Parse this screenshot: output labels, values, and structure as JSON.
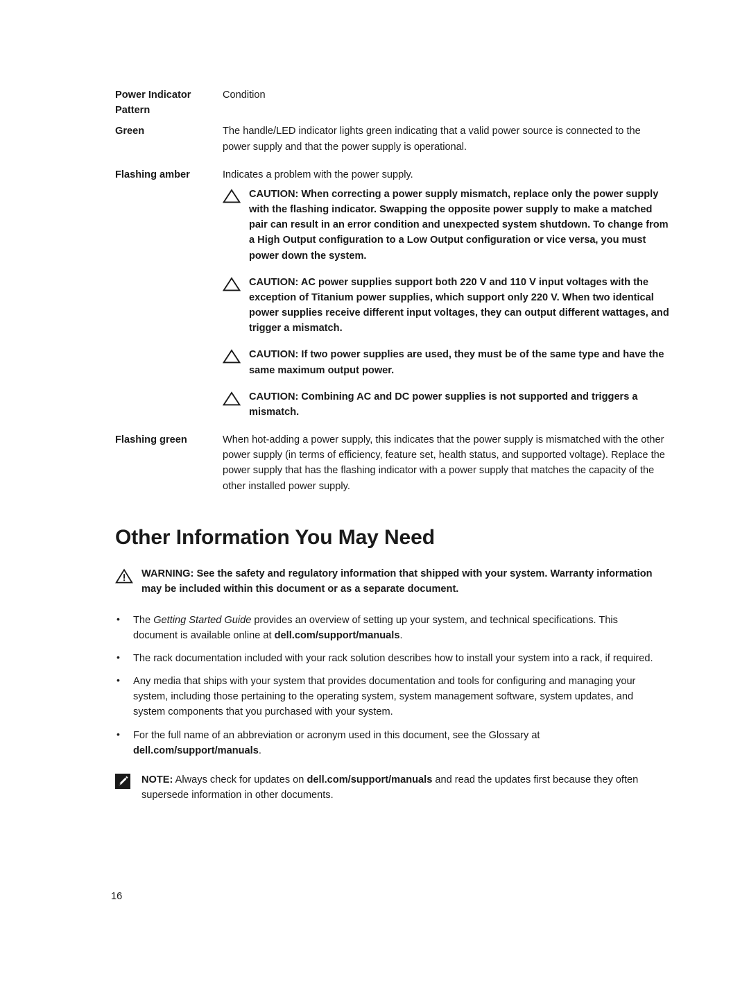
{
  "page": {
    "number": "16",
    "background_color": "#ffffff",
    "text_color": "#1a1a1a"
  },
  "indicator_table": {
    "headers": {
      "col1": "Power Indicator Pattern",
      "col2": "Condition"
    },
    "rows": [
      {
        "label": "Green",
        "condition": "The handle/LED indicator lights green indicating that a valid power source is connected to the power supply and that the power supply is operational."
      },
      {
        "label": "Flashing amber",
        "condition": "Indicates a problem with the power supply."
      },
      {
        "label": "Flashing green",
        "condition": "When hot-adding a power supply, this indicates that the power supply is mismatched with the other power supply (in terms of efficiency, feature set, health status, and supported voltage). Replace the power supply that has the flashing indicator with a power supply that matches the capacity of the other installed power supply."
      }
    ]
  },
  "cautions": [
    {
      "icon": "caution-triangle-icon",
      "text": "CAUTION: When correcting a power supply mismatch, replace only the power supply with the flashing indicator. Swapping the opposite power supply to make a matched pair can result in an error condition and unexpected system shutdown. To change from a High Output configuration to a Low Output configuration or vice versa, you must power down the system."
    },
    {
      "icon": "caution-triangle-icon",
      "text": "CAUTION: AC power supplies support both 220 V and 110 V input voltages with the exception of Titanium power supplies, which support only 220 V. When two identical power supplies receive different input voltages, they can output different wattages, and trigger a mismatch."
    },
    {
      "icon": "caution-triangle-icon",
      "text": "CAUTION: If two power supplies are used, they must be of the same type and have the same maximum output power."
    },
    {
      "icon": "caution-triangle-icon",
      "text": "CAUTION: Combining AC and DC power supplies is not supported and triggers a mismatch."
    }
  ],
  "section": {
    "heading": "Other Information You May Need",
    "warning": {
      "icon": "warning-triangle-exclamation-icon",
      "text": "WARNING: See the safety and regulatory information that shipped with your system. Warranty information may be included within this document or as a separate document."
    },
    "bullets": [
      {
        "bullet_glyph": "•",
        "parts": [
          {
            "type": "text",
            "value": "The "
          },
          {
            "type": "italic",
            "value": "Getting Started Guide"
          },
          {
            "type": "text",
            "value": " provides an overview of setting up your system, and technical specifications. This document is available online at "
          },
          {
            "type": "bold",
            "value": "dell.com/support/manuals"
          },
          {
            "type": "text",
            "value": "."
          }
        ]
      },
      {
        "bullet_glyph": "•",
        "parts": [
          {
            "type": "text",
            "value": "The rack documentation included with your rack solution describes how to install your system into a rack, if required."
          }
        ]
      },
      {
        "bullet_glyph": "•",
        "parts": [
          {
            "type": "text",
            "value": "Any media that ships with your system that provides documentation and tools for configuring and managing your system, including those pertaining to the operating system, system management software, system updates, and system components that you purchased with your system."
          }
        ]
      },
      {
        "bullet_glyph": "•",
        "parts": [
          {
            "type": "text",
            "value": "For the full name of an abbreviation or acronym used in this document, see the Glossary at "
          },
          {
            "type": "bold",
            "value": "dell.com/support/manuals"
          },
          {
            "type": "text",
            "value": "."
          }
        ]
      }
    ],
    "note": {
      "icon": "note-pencil-icon",
      "parts": [
        {
          "type": "bold",
          "value": "NOTE:"
        },
        {
          "type": "text",
          "value": " Always check for updates on "
        },
        {
          "type": "bold",
          "value": "dell.com/support/manuals"
        },
        {
          "type": "text",
          "value": " and read the updates first because they often supersede information in other documents."
        }
      ]
    }
  }
}
